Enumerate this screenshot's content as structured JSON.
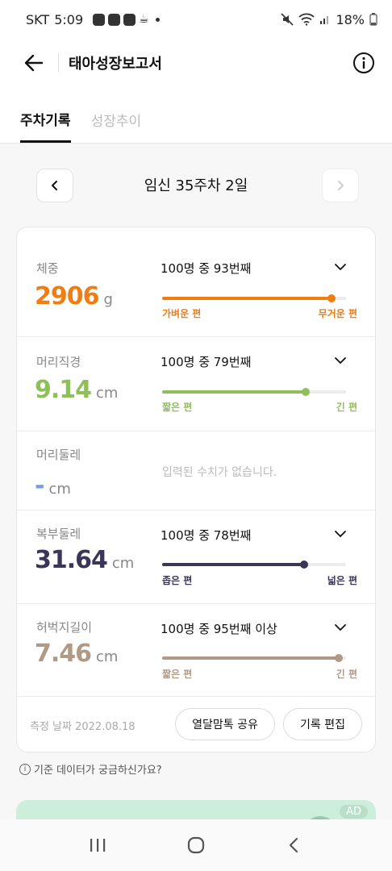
{
  "status": {
    "carrier": "SKT",
    "time": "5:09",
    "battery": "18%"
  },
  "appbar": {
    "title": "태아성장보고서"
  },
  "tabs": [
    {
      "label": "주차기록",
      "active": true
    },
    {
      "label": "성장추이",
      "active": false
    }
  ],
  "week": {
    "label": "임신 35주차 2일"
  },
  "metrics": [
    {
      "name": "체중",
      "value": "2906",
      "unit": "g",
      "rank": "100명 중 93번째",
      "position_pct": 92,
      "low_label": "가벼운 편",
      "high_label": "무거운 편",
      "color": "#f07c12"
    },
    {
      "name": "머리직경",
      "value": "9.14",
      "unit": "cm",
      "rank": "100명 중 79번째",
      "position_pct": 78,
      "low_label": "짧은 편",
      "high_label": "긴 편",
      "color": "#8fbf5a"
    },
    {
      "name": "머리둘레",
      "value": "-",
      "unit": "cm",
      "empty_message": "입력된 수치가 없습니다.",
      "color": "#6f9fe0"
    },
    {
      "name": "복부둘레",
      "value": "31.64",
      "unit": "cm",
      "rank": "100명 중 78번째",
      "position_pct": 77,
      "low_label": "좁은 편",
      "high_label": "넓은 편",
      "color": "#3b3657"
    },
    {
      "name": "허벅지길이",
      "value": "7.46",
      "unit": "cm",
      "rank": "100명 중 95번째 이상",
      "position_pct": 96,
      "low_label": "짧은 편",
      "high_label": "긴 편",
      "color": "#b09a86"
    }
  ],
  "footer": {
    "measure_date": "측정 날짜 2022.08.18",
    "share_label": "열달맘톡 공유",
    "edit_label": "기록 편집"
  },
  "help": {
    "text": "기준 데이터가 궁금하신가요?"
  },
  "ad": {
    "badge": "AD"
  }
}
